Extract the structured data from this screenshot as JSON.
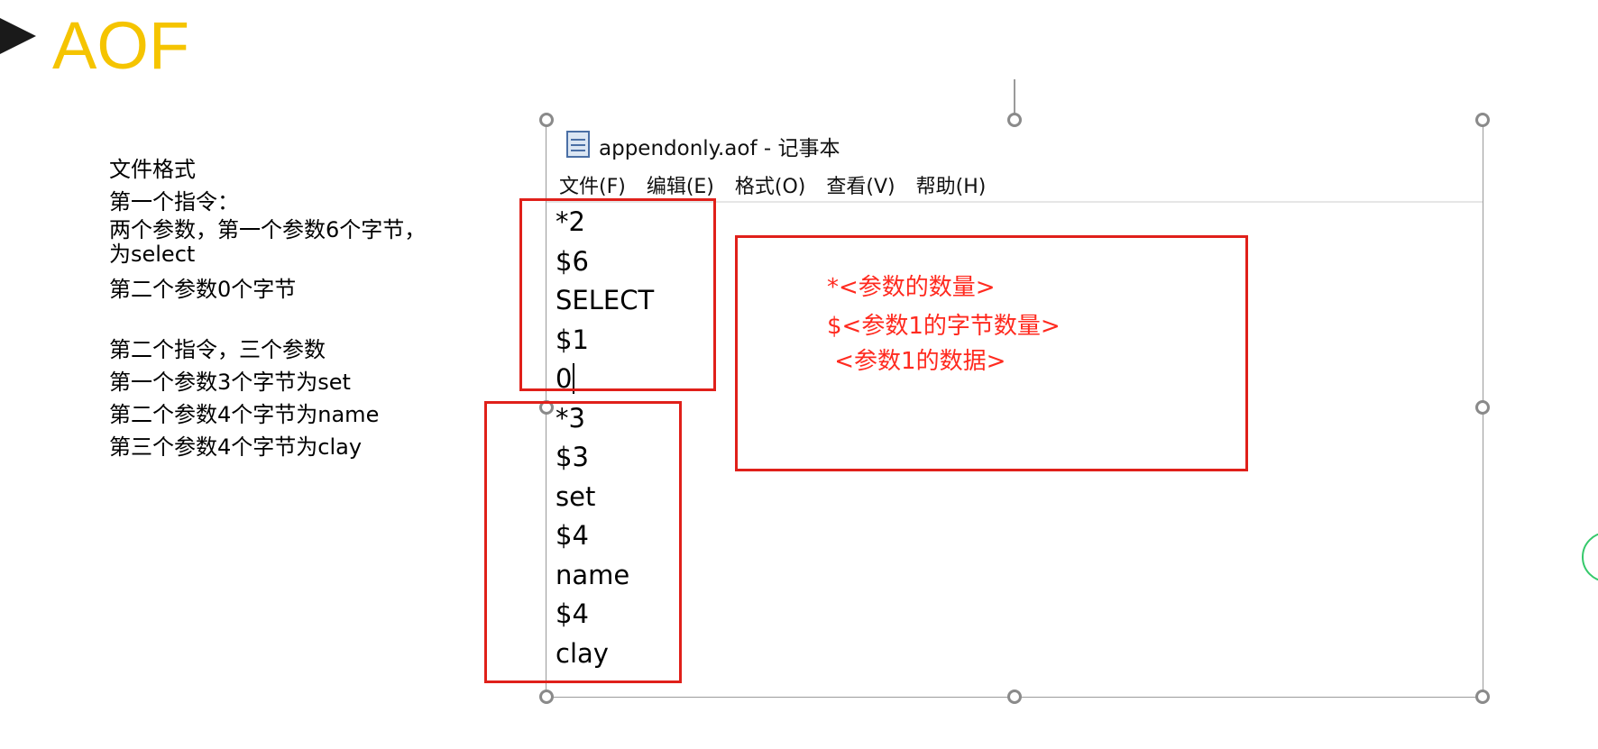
{
  "slide": {
    "title": "AOF"
  },
  "notes": {
    "line1": "文件格式",
    "line2": "第一个指令：",
    "line3a": "两个参数，第一个参数6个字节，",
    "line3b": "为select",
    "line4": "第二个参数0个字节",
    "line5": "第二个指令，三个参数",
    "line6": "第一个参数3个字节为set",
    "line7": "第二个参数4个字节为name",
    "line8": "第三个参数4个字节为clay"
  },
  "notepad": {
    "title": "appendonly.aof - 记事本",
    "icon": "notepad-icon",
    "menu": [
      "文件(F)",
      "编辑(E)",
      "格式(O)",
      "查看(V)",
      "帮助(H)"
    ],
    "lines": [
      "*2",
      "$6",
      "SELECT",
      "$1",
      "0",
      "*3",
      "$3",
      "set",
      "$4",
      "name",
      "$4",
      "clay"
    ]
  },
  "annotation": {
    "line1": "*<参数的数量>",
    "line2": "$<参数1的字节数量>",
    "line3": " <参数1的数据>",
    "color": "#ff2a1f"
  },
  "colors": {
    "title": "#f5c400",
    "box": "#e0201a",
    "selection": "#9a9a9a"
  }
}
